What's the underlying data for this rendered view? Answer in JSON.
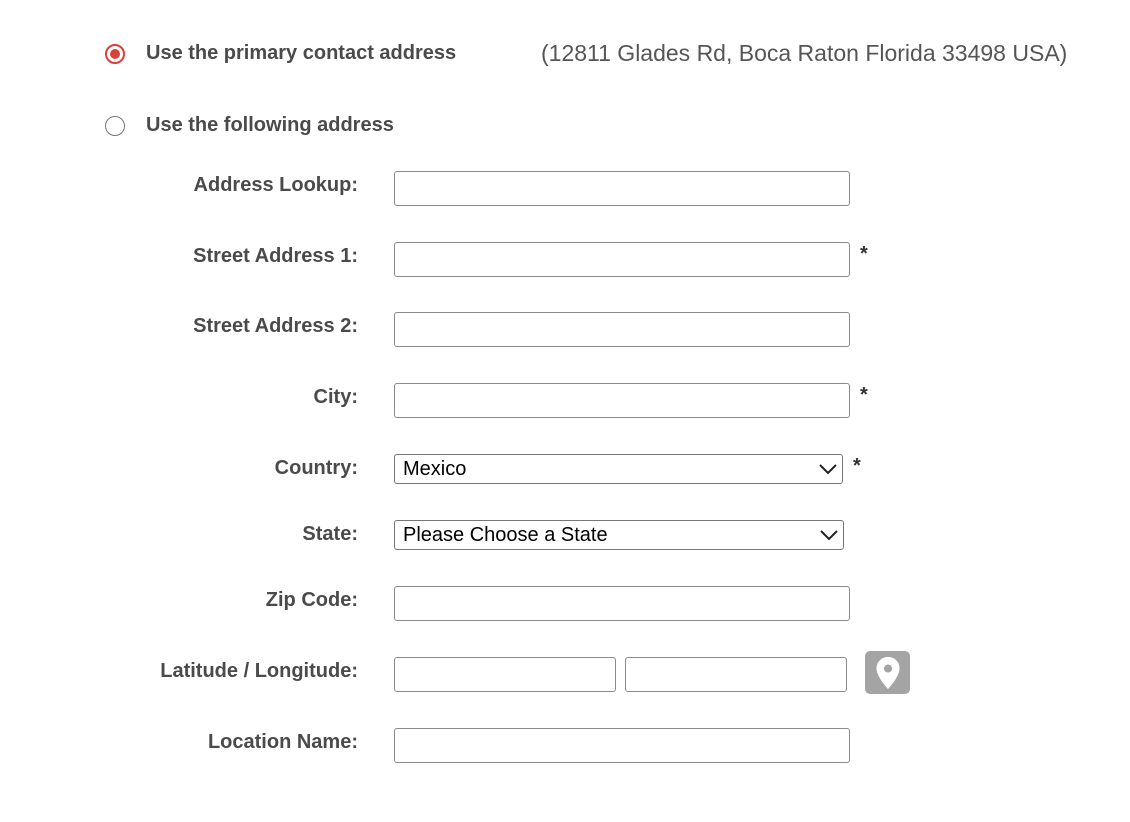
{
  "address_choice": {
    "primary_option_label": "Use the primary contact address",
    "primary_address_text": "(12811 Glades Rd, Boca Raton Florida 33498 USA)",
    "primary_selected": true,
    "following_option_label": "Use the following address",
    "following_selected": false
  },
  "form": {
    "address_lookup": {
      "label": "Address Lookup:",
      "value": ""
    },
    "street_address_1": {
      "label": "Street Address 1:",
      "value": "",
      "required_mark": "*"
    },
    "street_address_2": {
      "label": "Street Address 2:",
      "value": ""
    },
    "city": {
      "label": "City:",
      "value": "",
      "required_mark": "*"
    },
    "country": {
      "label": "Country:",
      "selected": "Mexico",
      "required_mark": "*"
    },
    "state": {
      "label": "State:",
      "selected": "Please Choose a State"
    },
    "zip_code": {
      "label": "Zip Code:",
      "value": ""
    },
    "lat_long": {
      "label": "Latitude / Longitude:",
      "latitude": "",
      "longitude": "",
      "icon": "map-pin-icon"
    },
    "location_name": {
      "label": "Location Name:",
      "value": ""
    }
  },
  "colors": {
    "radio_selected": "#d9403a",
    "label_text": "#4a4a4a",
    "map_button_bg": "#a4a4a4"
  }
}
